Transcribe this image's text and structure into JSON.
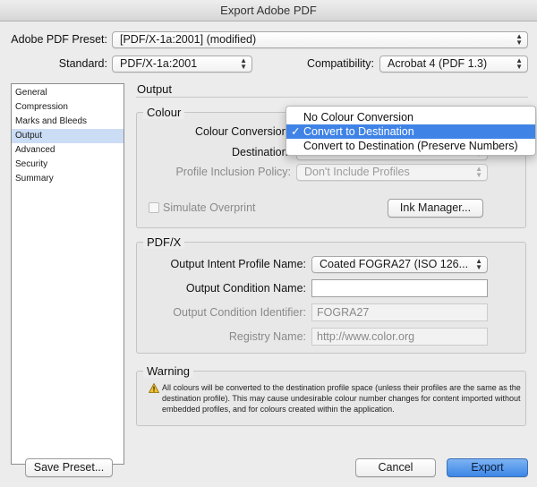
{
  "window": {
    "title": "Export Adobe PDF"
  },
  "preset": {
    "label": "Adobe PDF Preset:",
    "value": "[PDF/X-1a:2001] (modified)"
  },
  "standard": {
    "label": "Standard:",
    "value": "PDF/X-1a:2001"
  },
  "compatibility": {
    "label": "Compatibility:",
    "value": "Acrobat 4 (PDF 1.3)"
  },
  "sidebar": {
    "items": [
      {
        "label": "General"
      },
      {
        "label": "Compression"
      },
      {
        "label": "Marks and Bleeds"
      },
      {
        "label": "Output",
        "selected": true
      },
      {
        "label": "Advanced"
      },
      {
        "label": "Security"
      },
      {
        "label": "Summary"
      }
    ]
  },
  "panel": {
    "title": "Output"
  },
  "colour": {
    "group_label": "Colour",
    "conversion_label": "Colour Conversion:",
    "destination_label": "Destination:",
    "profile_policy_label": "Profile Inclusion Policy:",
    "profile_policy_value": "Don't Include Profiles",
    "simulate_overprint_label": "Simulate Overprint",
    "ink_manager_label": "Ink Manager..."
  },
  "conversion_menu": {
    "options": [
      {
        "label": "No Colour Conversion"
      },
      {
        "label": "Convert to Destination",
        "selected": true
      },
      {
        "label": "Convert to Destination (Preserve Numbers)"
      }
    ],
    "check_mark": "✓"
  },
  "pdfx": {
    "group_label": "PDF/X",
    "output_intent_label": "Output Intent Profile Name:",
    "output_intent_value": "Coated FOGRA27 (ISO 126...",
    "output_condition_name_label": "Output Condition Name:",
    "output_condition_name_value": "",
    "output_condition_identifier_label": "Output Condition Identifier:",
    "output_condition_identifier_value": "FOGRA27",
    "registry_name_label": "Registry Name:",
    "registry_name_value": "http://www.color.org"
  },
  "warning": {
    "group_label": "Warning",
    "text": "All colours will be converted to the destination profile space (unless their profiles are the same as the destination profile). This may cause undesirable colour number changes for content imported without embedded profiles, and for colours created within the application."
  },
  "footer": {
    "save_preset_label": "Save Preset...",
    "cancel_label": "Cancel",
    "export_label": "Export"
  },
  "colors": {
    "accent": "#3f83e6",
    "sidebar_selection": "#cbdcf5",
    "default_button": "#3c86e6"
  }
}
